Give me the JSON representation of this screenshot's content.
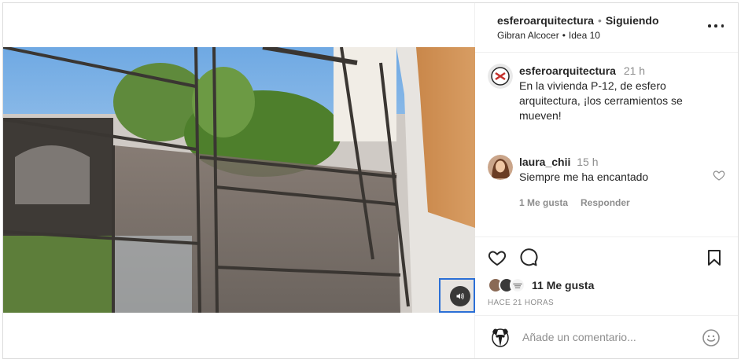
{
  "post": {
    "author": "esferoarquitectura",
    "separator": "•",
    "follow_status": "Siguiendo",
    "collaborator": "Gibran Alcocer",
    "audio_separator": "•",
    "audio_title": "Idea 10"
  },
  "caption": {
    "username": "esferoarquitectura",
    "time": "21 h",
    "text": "En la vivienda P-12, de esfero arquitectura, ¡los cerramientos se mueven!"
  },
  "comments": [
    {
      "username": "laura_chii",
      "time": "15 h",
      "text": "Siempre me ha encantado",
      "likes_label": "1 Me gusta",
      "reply_label": "Responder"
    }
  ],
  "likes": {
    "count_label": "11 Me gusta"
  },
  "timestamp": "HACE 21 HORAS",
  "add_comment": {
    "placeholder": "Añade un comentario..."
  },
  "icons": {
    "more": "more-horizontal-icon",
    "like": "heart-icon",
    "comment": "comment-bubble-icon",
    "save": "bookmark-icon",
    "sound": "speaker-icon",
    "emoji": "emoji-icon"
  },
  "colors": {
    "text": "#262626",
    "secondary": "#8e8e8e",
    "border": "#dbdbdb",
    "focus": "#2b6fd6"
  }
}
